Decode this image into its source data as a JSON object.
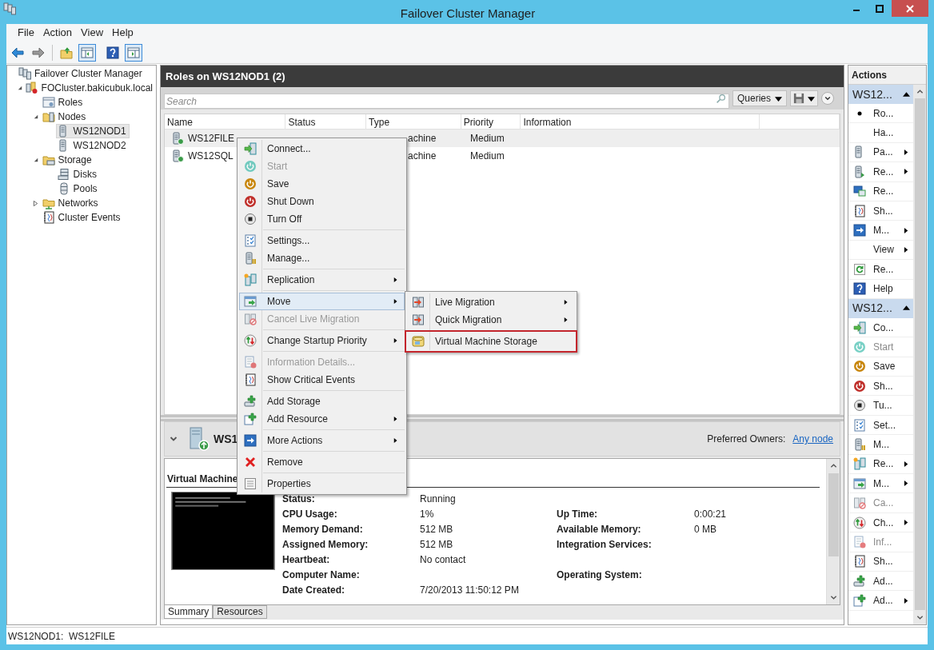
{
  "window": {
    "title": "Failover Cluster Manager"
  },
  "menu_bar": [
    "File",
    "Action",
    "View",
    "Help"
  ],
  "toolbar": [
    {
      "kind": "back",
      "pressed": false
    },
    {
      "kind": "forward",
      "pressed": false
    },
    {
      "kind": "up",
      "pressed": false
    },
    {
      "kind": "tree",
      "pressed": true
    },
    {
      "kind": "help",
      "pressed": false
    },
    {
      "kind": "pane",
      "pressed": true
    }
  ],
  "tree": [
    {
      "label": "Failover Cluster Manager",
      "kind": "cluster",
      "selected": false,
      "children": [
        {
          "label": "FOCluster.bakicubuk.local",
          "kind": "domain",
          "selected": false,
          "expanded": true,
          "children": [
            {
              "label": "Roles",
              "kind": "roles",
              "selected": false
            },
            {
              "label": "Nodes",
              "kind": "nodes",
              "selected": false,
              "expanded": true,
              "children": [
                {
                  "label": "WS12NOD1",
                  "kind": "server",
                  "selected": true
                },
                {
                  "label": "WS12NOD2",
                  "kind": "server",
                  "selected": false
                }
              ]
            },
            {
              "label": "Storage",
              "kind": "storage_folder",
              "selected": false,
              "expanded": true,
              "children": [
                {
                  "label": "Disks",
                  "kind": "disks",
                  "selected": false
                },
                {
                  "label": "Pools",
                  "kind": "pools",
                  "selected": false
                }
              ]
            },
            {
              "label": "Networks",
              "kind": "networks",
              "selected": false,
              "expanded": false
            },
            {
              "label": "Cluster Events",
              "kind": "events",
              "selected": false
            }
          ]
        }
      ]
    }
  ],
  "center": {
    "title": "Roles on WS12NOD1 (2)",
    "search": {
      "placeholder": "Search"
    },
    "queries_button": "Queries",
    "table": {
      "columns": [
        "Name",
        "Status",
        "Type",
        "Priority",
        "Information"
      ],
      "rows": [
        {
          "name": "WS12FILE",
          "type": "achine",
          "priority": "Medium",
          "selected": true
        },
        {
          "name": "WS12SQL",
          "type": "achine",
          "priority": "Medium",
          "selected": false
        }
      ]
    }
  },
  "details": {
    "name": "WS1",
    "preferred_owners_label": "Preferred Owners:",
    "preferred_owners_link": "Any node",
    "heading": "Virtual Machine",
    "rows": [
      {
        "label": "Status:",
        "value": "Running"
      },
      {
        "label": "CPU Usage:",
        "value": "1%",
        "right_label": "Up Time:",
        "right_value": "0:00:21"
      },
      {
        "label": "Memory Demand:",
        "value": "512 MB",
        "right_label": "Available Memory:",
        "right_value": "0 MB"
      },
      {
        "label": "Assigned Memory:",
        "value": "512 MB",
        "right_label": "Integration Services:"
      },
      {
        "label": "Heartbeat:",
        "value": "No contact"
      },
      {
        "label": "Computer Name:",
        "right_label": "Operating System:"
      },
      {
        "label": "Date Created:",
        "value": "7/20/2013 11:50:12 PM"
      }
    ],
    "tabs": [
      {
        "label": "Summary",
        "selected": true
      },
      {
        "label": "Resources",
        "selected": false
      }
    ]
  },
  "context_menu": {
    "groups": [
      [
        {
          "label": "Connect...",
          "kind": "connect",
          "disabled": false,
          "submenu": false,
          "selected": false
        },
        {
          "label": "Start",
          "kind": "power_teal",
          "disabled": true,
          "submenu": false,
          "selected": false
        },
        {
          "label": "Save",
          "kind": "power_orange",
          "disabled": false,
          "submenu": false,
          "selected": false
        },
        {
          "label": "Shut Down",
          "kind": "power_red",
          "disabled": false,
          "submenu": false,
          "selected": false
        },
        {
          "label": "Turn Off",
          "kind": "stop",
          "disabled": false,
          "submenu": false,
          "selected": false
        }
      ],
      [
        {
          "label": "Settings...",
          "kind": "settings",
          "disabled": false,
          "submenu": false,
          "selected": false
        },
        {
          "label": "Manage...",
          "kind": "manage",
          "disabled": false,
          "submenu": false,
          "selected": false
        }
      ],
      [
        {
          "label": "Replication",
          "kind": "replication",
          "disabled": false,
          "submenu": true,
          "selected": false
        }
      ],
      [
        {
          "label": "Move",
          "kind": "move",
          "disabled": false,
          "submenu": true,
          "selected": true
        },
        {
          "label": "Cancel Live Migration",
          "kind": "cancel",
          "disabled": true,
          "submenu": false,
          "selected": false
        }
      ],
      [
        {
          "label": "Change Startup Priority",
          "kind": "priority",
          "disabled": false,
          "submenu": true,
          "selected": false
        }
      ],
      [
        {
          "label": "Information Details...",
          "kind": "info",
          "disabled": true,
          "submenu": false,
          "selected": false
        },
        {
          "label": "Show Critical Events",
          "kind": "events",
          "disabled": false,
          "submenu": false,
          "selected": false
        }
      ],
      [
        {
          "label": "Add Storage",
          "kind": "add_storage",
          "disabled": false,
          "submenu": false,
          "selected": false
        },
        {
          "label": "Add Resource",
          "kind": "add_resource",
          "disabled": false,
          "submenu": true,
          "selected": false
        }
      ],
      [
        {
          "label": "More Actions",
          "kind": "more",
          "disabled": false,
          "submenu": true,
          "selected": false
        }
      ],
      [
        {
          "label": "Remove",
          "kind": "remove",
          "disabled": false,
          "submenu": false,
          "selected": false
        }
      ],
      [
        {
          "label": "Properties",
          "kind": "properties",
          "disabled": false,
          "submenu": false,
          "selected": false
        }
      ]
    ]
  },
  "submenu": {
    "groups": [
      [
        {
          "label": "Live Migration",
          "kind": "migrate",
          "submenu": true,
          "highlighted": false
        },
        {
          "label": "Quick Migration",
          "kind": "migrate",
          "submenu": true,
          "highlighted": false
        }
      ],
      [
        {
          "label": "Virtual Machine Storage",
          "kind": "storage",
          "submenu": false,
          "highlighted": true
        }
      ]
    ]
  },
  "actions": {
    "title": "Actions",
    "sections": [
      {
        "title": "WS12...",
        "expanded": true,
        "items": [
          {
            "label": "Ro...",
            "kind": "bullet",
            "disabled": false,
            "submenu": false
          },
          {
            "label": "Ha...",
            "kind": "none",
            "disabled": false,
            "submenu": false
          },
          {
            "label": "Pa...",
            "kind": "server",
            "disabled": false,
            "submenu": true
          },
          {
            "label": "Re...",
            "kind": "server_arrow",
            "disabled": false,
            "submenu": true
          },
          {
            "label": "Re...",
            "kind": "remote",
            "disabled": false,
            "submenu": false
          },
          {
            "label": "Sh...",
            "kind": "events",
            "disabled": false,
            "submenu": false
          },
          {
            "label": "M...",
            "kind": "more",
            "disabled": false,
            "submenu": true
          },
          {
            "label": "View",
            "kind": "none",
            "disabled": false,
            "submenu": true
          },
          {
            "label": "Re...",
            "kind": "refresh",
            "disabled": false,
            "submenu": false
          },
          {
            "label": "Help",
            "kind": "help",
            "disabled": false,
            "submenu": false
          }
        ]
      },
      {
        "title": "WS12...",
        "expanded": true,
        "items": [
          {
            "label": "Co...",
            "kind": "connect",
            "disabled": false,
            "submenu": false
          },
          {
            "label": "Start",
            "kind": "power_teal",
            "disabled": true,
            "submenu": false
          },
          {
            "label": "Save",
            "kind": "power_orange",
            "disabled": false,
            "submenu": false
          },
          {
            "label": "Sh...",
            "kind": "power_red",
            "disabled": false,
            "submenu": false
          },
          {
            "label": "Tu...",
            "kind": "stop",
            "disabled": false,
            "submenu": false
          },
          {
            "label": "Set...",
            "kind": "settings",
            "disabled": false,
            "submenu": false
          },
          {
            "label": "M...",
            "kind": "manage",
            "disabled": false,
            "submenu": false
          },
          {
            "label": "Re...",
            "kind": "replication",
            "disabled": false,
            "submenu": true
          },
          {
            "label": "M...",
            "kind": "move",
            "disabled": false,
            "submenu": true
          },
          {
            "label": "Ca...",
            "kind": "cancel",
            "disabled": true,
            "submenu": false
          },
          {
            "label": "Ch...",
            "kind": "priority",
            "disabled": false,
            "submenu": true
          },
          {
            "label": "Inf...",
            "kind": "info",
            "disabled": true,
            "submenu": false
          },
          {
            "label": "Sh...",
            "kind": "events",
            "disabled": false,
            "submenu": false
          },
          {
            "label": "Ad...",
            "kind": "add_storage",
            "disabled": false,
            "submenu": false
          },
          {
            "label": "Ad...",
            "kind": "add_resource",
            "disabled": false,
            "submenu": true
          }
        ]
      }
    ]
  },
  "status_bar": "WS12NOD1:  WS12FILE"
}
